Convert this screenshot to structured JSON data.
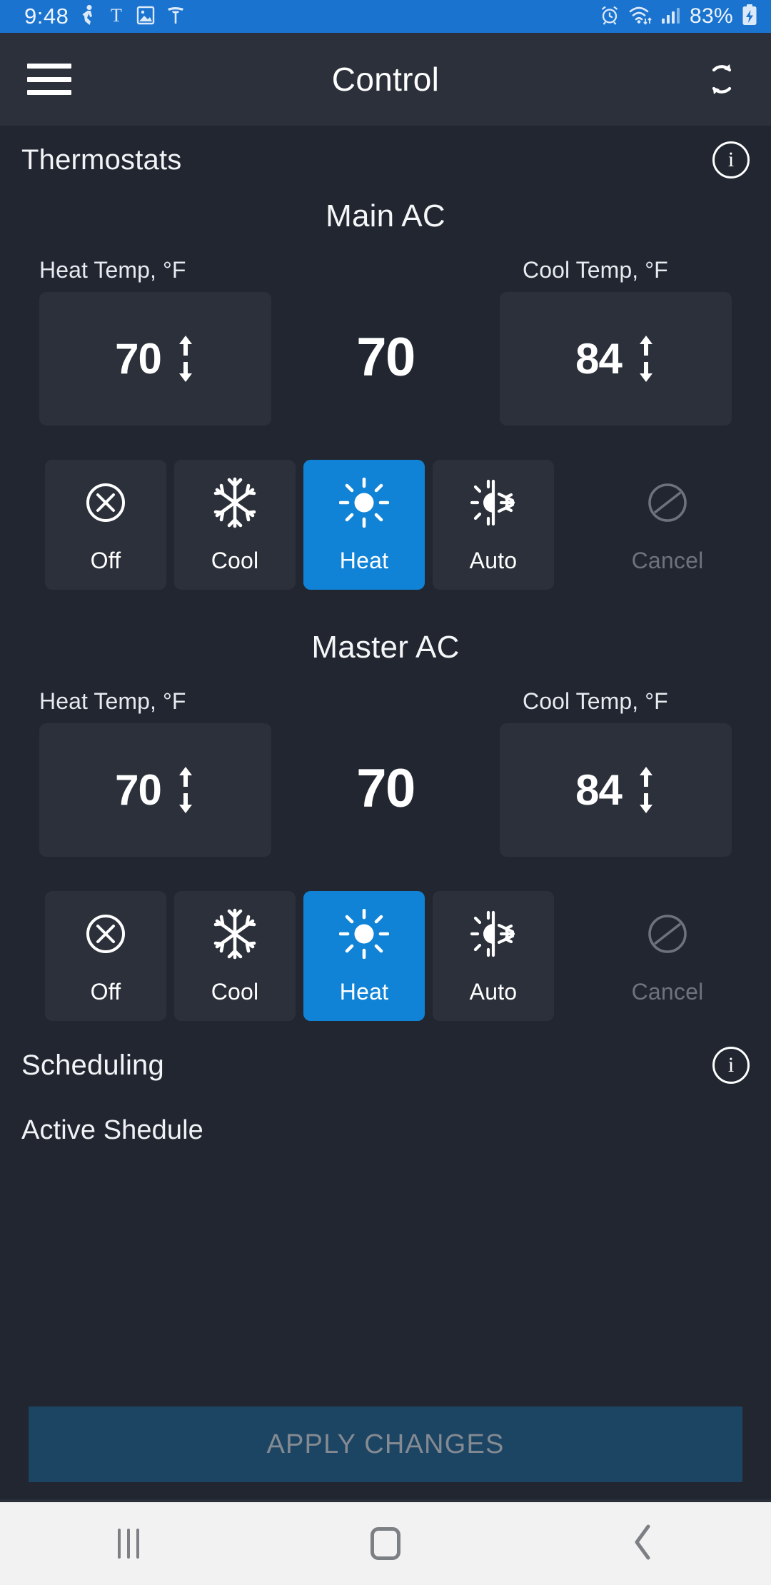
{
  "status_bar": {
    "time": "9:48",
    "battery_percent": "83%",
    "left_icons": [
      "runkeeper-icon",
      "nytimes-icon",
      "photos-icon",
      "tesla-icon"
    ],
    "right_icons": [
      "alarm-icon",
      "wifi-icon",
      "cellular-signal-icon",
      "battery-charging-icon"
    ],
    "background_color": "#1a73cf"
  },
  "appbar": {
    "title": "Control",
    "menu_icon": "hamburger-menu-icon",
    "action_icon": "refresh-sync-icon",
    "background_color": "#2b303a"
  },
  "thermostats": {
    "section_title": "Thermostats",
    "info_label": "i",
    "heat_label": "Heat Temp, °F",
    "cool_label": "Cool Temp, °F",
    "devices": [
      {
        "name": "Main AC",
        "heat_temp": "70",
        "current_temp": "70",
        "cool_temp": "84",
        "active_mode": "Heat",
        "modes": [
          {
            "label": "Off",
            "icon": "power-off-circle-icon",
            "active": false
          },
          {
            "label": "Cool",
            "icon": "snowflake-icon",
            "active": false
          },
          {
            "label": "Heat",
            "icon": "sun-icon",
            "active": true
          },
          {
            "label": "Auto",
            "icon": "sun-snowflake-auto-icon",
            "active": false
          },
          {
            "label": "Cancel",
            "icon": "no-entry-slash-icon",
            "active": false,
            "disabled": true
          }
        ]
      },
      {
        "name": "Master AC",
        "heat_temp": "70",
        "current_temp": "70",
        "cool_temp": "84",
        "active_mode": "Heat",
        "modes": [
          {
            "label": "Off",
            "icon": "power-off-circle-icon",
            "active": false
          },
          {
            "label": "Cool",
            "icon": "snowflake-icon",
            "active": false
          },
          {
            "label": "Heat",
            "icon": "sun-icon",
            "active": true
          },
          {
            "label": "Auto",
            "icon": "sun-snowflake-auto-icon",
            "active": false
          },
          {
            "label": "Cancel",
            "icon": "no-entry-slash-icon",
            "active": false,
            "disabled": true
          }
        ]
      }
    ]
  },
  "scheduling": {
    "section_title": "Scheduling",
    "info_label": "i",
    "active_schedule_label": "Active Shedule"
  },
  "apply": {
    "label": "APPLY CHANGES",
    "background_color": "#1c4463",
    "text_color": "#848a92"
  },
  "navbar": {
    "recents_icon": "recents-icon",
    "home_icon": "home-icon",
    "back_icon": "back-chevron-icon",
    "background_color": "#f2f2f2"
  },
  "theme": {
    "page_background": "#212630",
    "panel_background": "#2b303a",
    "accent": "#1183d6"
  }
}
